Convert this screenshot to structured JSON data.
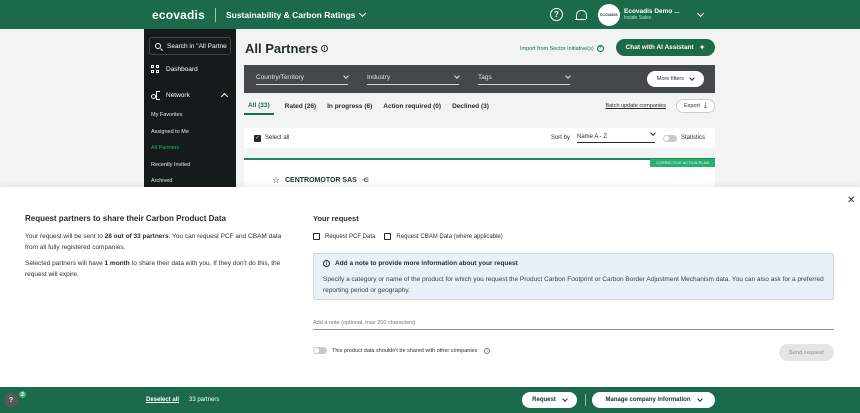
{
  "topbar": {
    "logo": "ecovadis",
    "app_title": "Sustainability & Carbon Ratings",
    "help_icon": "?",
    "avatar_text": "ECOVADIS",
    "user_name": "Ecovadis Demo ...",
    "user_role": "Inside Sales"
  },
  "sidebar": {
    "search_label": "Search in \"All Partne",
    "dashboard": "Dashboard",
    "network": "Network",
    "items": [
      {
        "label": "My Favorites"
      },
      {
        "label": "Assigned to Me"
      },
      {
        "label": "All Partners"
      },
      {
        "label": "Recently Invited"
      },
      {
        "label": "Archived"
      }
    ]
  },
  "main": {
    "title": "All Partners",
    "import_link": "Import from Sector Initiative(s)",
    "chat_button": "Chat with AI Assistant",
    "filters": {
      "country": "Country/Territory",
      "industry": "Industry",
      "tags": "Tags",
      "more": "More filters"
    },
    "tabs": [
      {
        "label": "All (33)"
      },
      {
        "label": "Rated (26)"
      },
      {
        "label": "In progress (6)"
      },
      {
        "label": "Action required (0)"
      },
      {
        "label": "Declined (3)"
      }
    ],
    "batch_link": "Batch update companies",
    "export": "Export",
    "select_all": "Select all",
    "sort_by": "Sort by",
    "sort_value": "Name A - Z",
    "statistics": "Statistics",
    "badge": "CORRECTIVE ACTION PLAN",
    "company": "CENTROMOTOR SAS"
  },
  "panel": {
    "title": "Request partners to share their Carbon Product Data",
    "p1_pre": "Your request will be sent to ",
    "p1_bold": "28 out of 33 partners",
    "p1_post": ". You can request PCF and CBAM data from all fully registered companies.",
    "p2_pre": "Selected partners will have ",
    "p2_bold": "1 month",
    "p2_post": " to share their data with you. If they don't do this, the request will expire.",
    "request_title": "Your request",
    "opt_pcf": "Request PCF Data",
    "opt_cbam": "Request CBAM Data (where applicable)",
    "info_title": "Add a note to provide more information about your request",
    "info_text": "Specify a category or name of the product for which you request the Product Carbon Footprint or Carbon Border Adjustment Mechanism data. You can also ask for a preferred reporting period or geography.",
    "note_placeholder": "Add a note (optional, max 200 characters)",
    "no_share": "This product data shouldn't be shared with other companies",
    "send": "Send request"
  },
  "bottombar": {
    "help_badge": "2",
    "help": "?",
    "deselect": "Deselect all",
    "count": "33 partners",
    "request": "Request",
    "manage": "Manage company information"
  },
  "colors": {
    "brand": "#1b6b4a",
    "accent": "#27b06f",
    "sidebar_bg": "#141b1a"
  }
}
